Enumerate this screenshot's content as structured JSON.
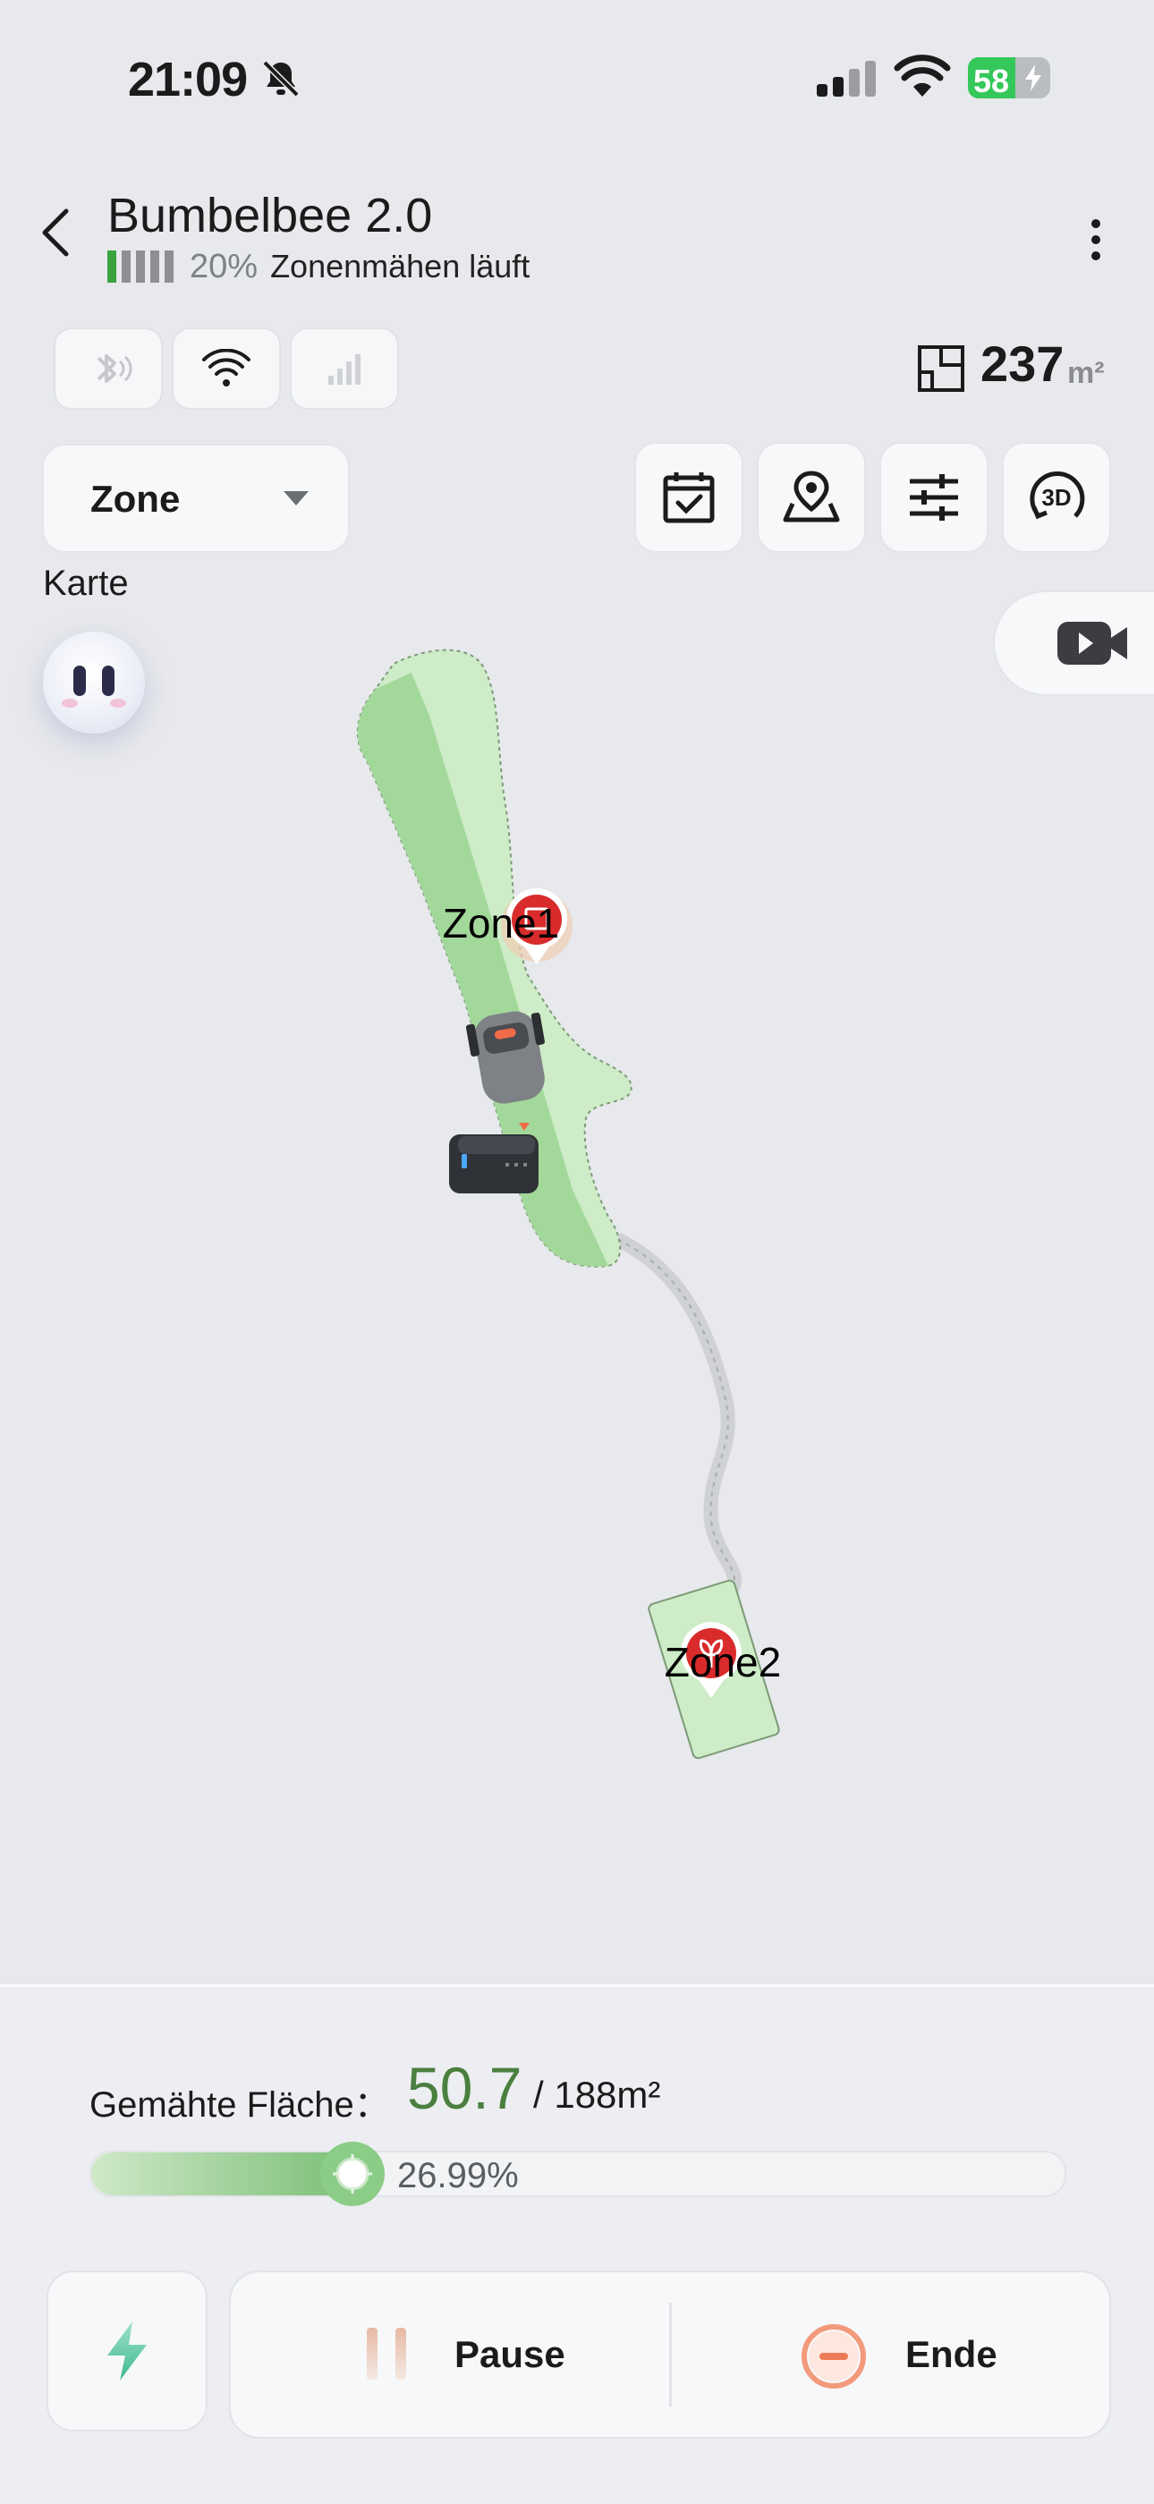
{
  "status_bar": {
    "time": "21:09",
    "battery": "58",
    "battery_level": 0.58
  },
  "header": {
    "title": "Bumbelbee 2.0",
    "battery_percent": "20%",
    "state": "Zonenmähen läuft",
    "area_value": "237",
    "area_unit": "m²"
  },
  "mode": {
    "selected": "Zone"
  },
  "map": {
    "label": "Karte",
    "zones": [
      {
        "name": "Zone1"
      },
      {
        "name": "Zone2"
      }
    ]
  },
  "progress": {
    "label": "Gemähte Fläche：",
    "mowed": "50.7",
    "total": "/ 188m²",
    "percent_text": "26.99%",
    "percent": 26.99
  },
  "actions": {
    "pause_label": "Pause",
    "end_label": "Ende"
  },
  "colors": {
    "accent_green": "#4a7f3f",
    "lawn": "#cdecc7",
    "marker_red": "#d92b2b"
  }
}
